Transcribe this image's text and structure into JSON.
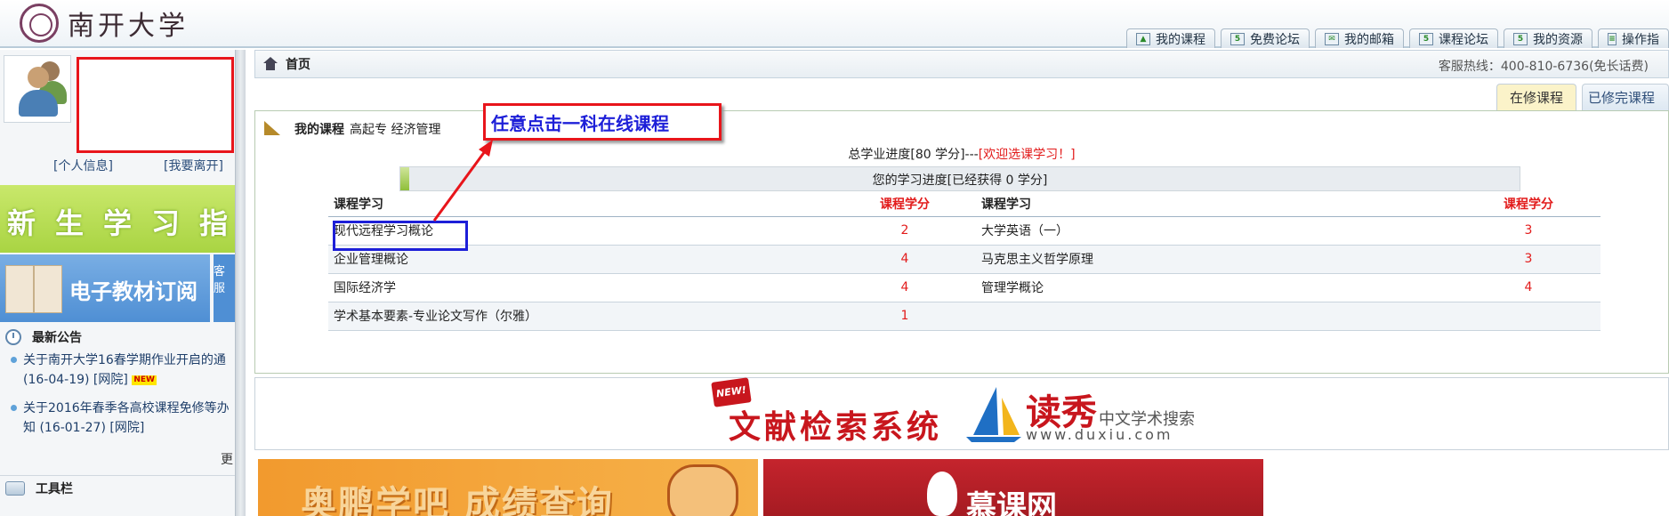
{
  "header": {
    "school_name": "南开大学",
    "top_tabs": [
      "我的课程",
      "免费论坛",
      "我的邮箱",
      "课程论坛",
      "我的资源",
      "操作指"
    ]
  },
  "sidebar": {
    "profile_link": "[个人信息]",
    "logout_link": "[我要离开]",
    "banner_guide": "新生学习指",
    "banner_textbook": "电子教材订阅",
    "banner_side": "客服",
    "notice_title": "最新公告",
    "notices": [
      {
        "title": "关于南开大学16春学期作业开启的通",
        "meta": "(16-04-19) [网院]",
        "badge": "NEW"
      },
      {
        "title": "关于2016年春季各高校课程免修等办",
        "meta": "知 (16-01-27) [网院]",
        "badge": ""
      }
    ],
    "more_label": "更",
    "toolbar_title": "工具栏"
  },
  "breadcrumb": {
    "title": "首页",
    "hotline": "客服热线：400-810-6736(免长话费)"
  },
  "subtabs": {
    "current": "在修课程",
    "finished": "已修完课程"
  },
  "course_panel": {
    "heading": "我的课程",
    "level": "高起专",
    "major": "经济管理",
    "total_progress_prefix": "总学业进度[80 学分]---",
    "total_progress_link": "[欢迎选课学习！]",
    "progress_text": "您的学习进度[已经获得 0 学分]",
    "progress_fraction": 0.0,
    "table": {
      "headers": [
        "课程学习",
        "课程学分",
        "课程学习",
        "课程学分"
      ],
      "rows": [
        [
          "现代远程学习概论",
          "2",
          "大学英语（一）",
          "3"
        ],
        [
          "企业管理概论",
          "4",
          "马克思主义哲学原理",
          "3"
        ],
        [
          "国际经济学",
          "4",
          "管理学概论",
          "4"
        ],
        [
          "学术基本要素-专业论文写作（尔雅）",
          "1",
          "",
          ""
        ]
      ]
    }
  },
  "annotation": {
    "callout_text": "任意点击一科在线课程"
  },
  "duxiu": {
    "new_badge": "NEW!",
    "title": "文献检索系统",
    "brand": "读秀",
    "subtitle": "中文学术搜索",
    "url": "www.duxiu.com"
  },
  "bottom_banners": {
    "left": "奥鹏学吧 成绩查询",
    "right": "慕课网"
  },
  "colors": {
    "accent_red": "#e21b1b",
    "annotation_blue": "#1d1fd8",
    "progress_green": "#8fbf3a"
  }
}
